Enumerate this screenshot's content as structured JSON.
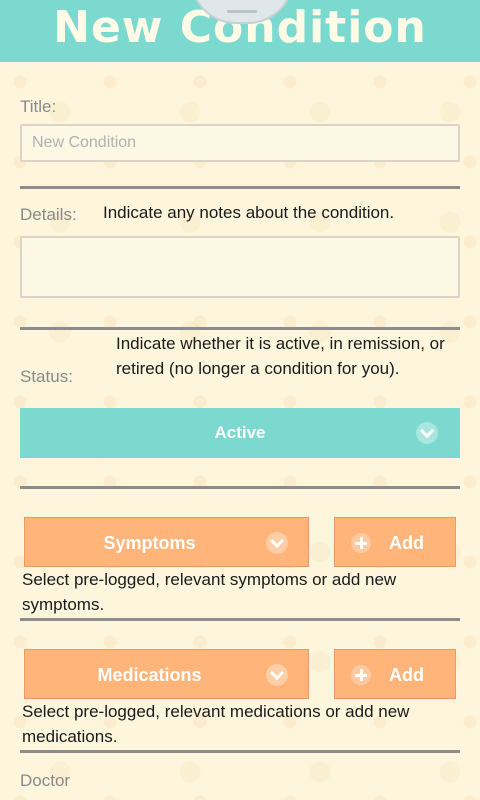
{
  "header": {
    "title": "New Condition"
  },
  "form": {
    "title_label": "Title:",
    "title_placeholder": "New Condition",
    "details_label": "Details:",
    "details_hint": "Indicate any notes about the condition.",
    "details_value": "",
    "status_label": "Status:",
    "status_hint": "Indicate whether it is active, in remission, or retired (no longer a condition for you).",
    "status_selected": "Active",
    "symptoms_label": "Symptoms",
    "symptoms_add": "Add",
    "symptoms_hint": "Select pre-logged, relevant symptoms or add new symptoms.",
    "medications_label": "Medications",
    "medications_add": "Add",
    "medications_hint": "Select pre-logged, relevant medications or add new medications.",
    "doctor_label": "Doctor"
  },
  "colors": {
    "accent": "#7cd9cf",
    "orange": "#ffb479",
    "background": "#fdf6dc"
  },
  "icons": {
    "dropdown": "chevron-down-icon",
    "add": "plus-icon"
  }
}
